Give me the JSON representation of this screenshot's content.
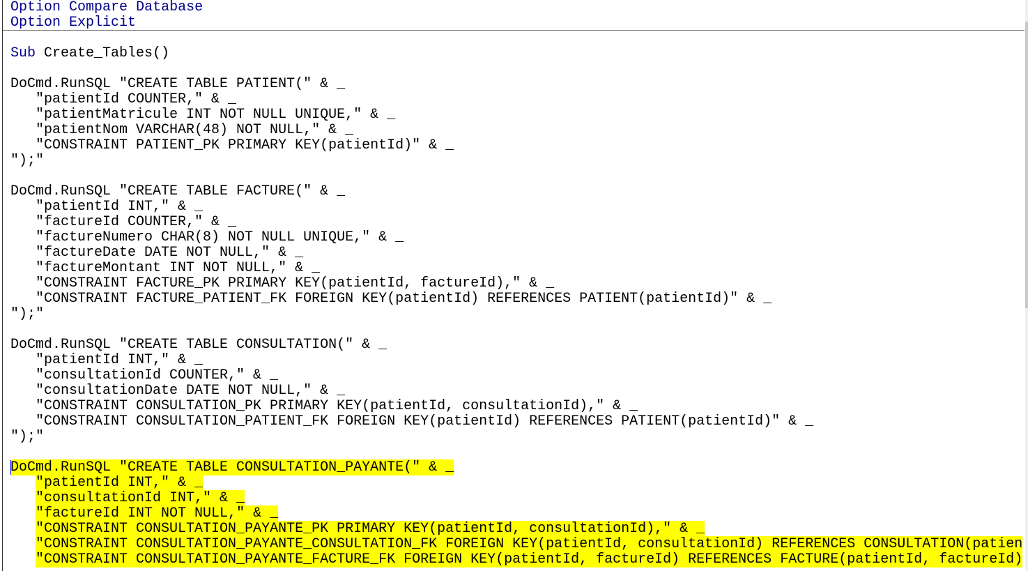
{
  "colors": {
    "keyword": "#00008b",
    "text": "#000000",
    "highlight": "#ffff00",
    "cursor": "#0000ff"
  },
  "lines": [
    {
      "tokens": [
        {
          "t": "Option",
          "k": true
        },
        {
          "t": " "
        },
        {
          "t": "Compare",
          "k": true
        },
        {
          "t": " "
        },
        {
          "t": "Database",
          "k": true
        }
      ]
    },
    {
      "tokens": [
        {
          "t": "Option",
          "k": true
        },
        {
          "t": " "
        },
        {
          "t": "Explicit",
          "k": true
        }
      ]
    },
    {
      "tokens": []
    },
    {
      "tokens": [
        {
          "t": "Sub",
          "k": true
        },
        {
          "t": " Create_Tables()"
        }
      ]
    },
    {
      "tokens": []
    },
    {
      "tokens": [
        {
          "t": "DoCmd.RunSQL \"CREATE TABLE PATIENT(\" & _"
        }
      ]
    },
    {
      "tokens": [
        {
          "t": "   \"patientId COUNTER,\" & _"
        }
      ]
    },
    {
      "tokens": [
        {
          "t": "   \"patientMatricule INT NOT NULL UNIQUE,\" & _"
        }
      ]
    },
    {
      "tokens": [
        {
          "t": "   \"patientNom VARCHAR(48) NOT NULL,\" & _"
        }
      ]
    },
    {
      "tokens": [
        {
          "t": "   \"CONSTRAINT PATIENT_PK PRIMARY KEY(patientId)\" & _"
        }
      ]
    },
    {
      "tokens": [
        {
          "t": "\");\""
        }
      ]
    },
    {
      "tokens": []
    },
    {
      "tokens": [
        {
          "t": "DoCmd.RunSQL \"CREATE TABLE FACTURE(\" & _"
        }
      ]
    },
    {
      "tokens": [
        {
          "t": "   \"patientId INT,\" & _"
        }
      ]
    },
    {
      "tokens": [
        {
          "t": "   \"factureId COUNTER,\" & _"
        }
      ]
    },
    {
      "tokens": [
        {
          "t": "   \"factureNumero CHAR(8) NOT NULL UNIQUE,\" & _"
        }
      ]
    },
    {
      "tokens": [
        {
          "t": "   \"factureDate DATE NOT NULL,\" & _"
        }
      ]
    },
    {
      "tokens": [
        {
          "t": "   \"factureMontant INT NOT NULL,\" & _"
        }
      ]
    },
    {
      "tokens": [
        {
          "t": "   \"CONSTRAINT FACTURE_PK PRIMARY KEY(patientId, factureId),\" & _"
        }
      ]
    },
    {
      "tokens": [
        {
          "t": "   \"CONSTRAINT FACTURE_PATIENT_FK FOREIGN KEY(patientId) REFERENCES PATIENT(patientId)\" & _"
        }
      ]
    },
    {
      "tokens": [
        {
          "t": "\");\""
        }
      ]
    },
    {
      "tokens": []
    },
    {
      "tokens": [
        {
          "t": "DoCmd.RunSQL \"CREATE TABLE CONSULTATION(\" & _"
        }
      ]
    },
    {
      "tokens": [
        {
          "t": "   \"patientId INT,\" & _"
        }
      ]
    },
    {
      "tokens": [
        {
          "t": "   \"consultationId COUNTER,\" & _"
        }
      ]
    },
    {
      "tokens": [
        {
          "t": "   \"consultationDate DATE NOT NULL,\" & _"
        }
      ]
    },
    {
      "tokens": [
        {
          "t": "   \"CONSTRAINT CONSULTATION_PK PRIMARY KEY(patientId, consultationId),\" & _"
        }
      ]
    },
    {
      "tokens": [
        {
          "t": "   \"CONSTRAINT CONSULTATION_PATIENT_FK FOREIGN KEY(patientId) REFERENCES PATIENT(patientId)\" & _"
        }
      ]
    },
    {
      "tokens": [
        {
          "t": "\");\""
        }
      ]
    },
    {
      "tokens": []
    },
    {
      "hl": true,
      "tokens": [
        {
          "t": "DoCmd.RunSQL \"CREATE TABLE CONSULTATION_PAYANTE(\" & _"
        }
      ]
    },
    {
      "hl": true,
      "tokens": [
        {
          "t": "   \"patientId INT,\" & _"
        }
      ]
    },
    {
      "hl": true,
      "tokens": [
        {
          "t": "   \"consultationId INT,\" & _"
        }
      ]
    },
    {
      "hl": true,
      "tokens": [
        {
          "t": "   \"factureId INT NOT NULL,\" & _"
        }
      ]
    },
    {
      "hl": true,
      "tokens": [
        {
          "t": "   \"CONSTRAINT CONSULTATION_PAYANTE_PK PRIMARY KEY(patientId, consultationId),\" & _"
        }
      ]
    },
    {
      "hl": true,
      "tokens": [
        {
          "t": "   \"CONSTRAINT CONSULTATION_PAYANTE_CONSULTATION_FK FOREIGN KEY(patientId, consultationId) REFERENCES CONSULTATION(patien"
        }
      ]
    },
    {
      "hl": true,
      "tokens": [
        {
          "t": "   \"CONSTRAINT CONSULTATION_PAYANTE_FACTURE_FK FOREIGN KEY(patientId, factureId) REFERENCES FACTURE(patientId, factureId)"
        }
      ]
    }
  ]
}
